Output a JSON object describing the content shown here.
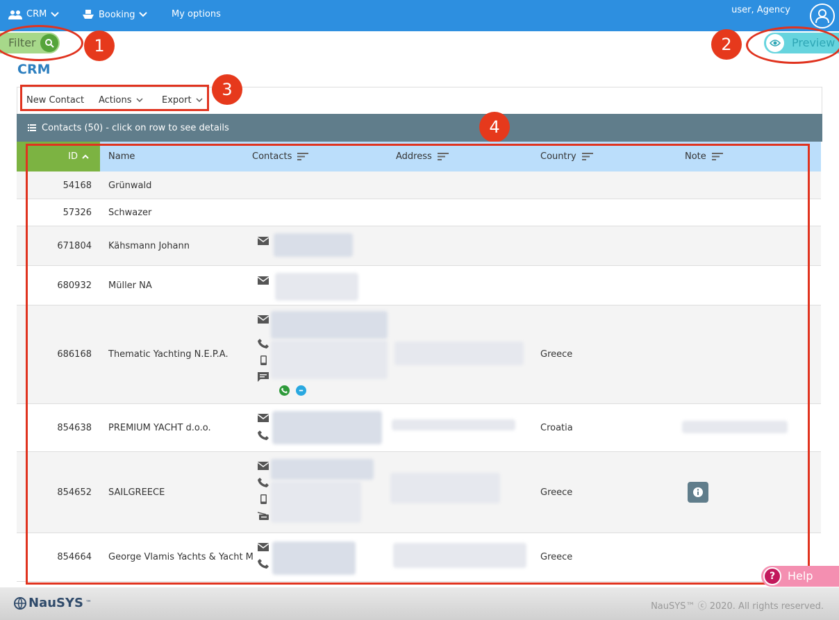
{
  "topbar": {
    "crm": "CRM",
    "booking": "Booking",
    "my_options": "My options",
    "user": "user, Agency",
    "bg_color": "#2d8fe0"
  },
  "filter_label": "Filter",
  "preview_label": "Preview",
  "page_title": "CRM",
  "toolbar": {
    "new_contact": "New Contact",
    "actions": "Actions",
    "export": "Export"
  },
  "panel_title": "Contacts (50) - click on row to see details",
  "annotations": [
    "1",
    "2",
    "3",
    "4"
  ],
  "table": {
    "columns": {
      "id": "ID",
      "name": "Name",
      "contacts": "Contacts",
      "address": "Address",
      "country": "Country",
      "note": "Note"
    },
    "rows": [
      {
        "id": "54168",
        "name": "Grünwald",
        "country": ""
      },
      {
        "id": "57326",
        "name": "Schwazer",
        "country": ""
      },
      {
        "id": "671804",
        "name": "Kähsmann Johann",
        "country": ""
      },
      {
        "id": "680932",
        "name": "Müller NA",
        "country": ""
      },
      {
        "id": "686168",
        "name": "Thematic Yachting N.E.P.A.",
        "country": "Greece"
      },
      {
        "id": "854638",
        "name": "PREMIUM YACHT d.o.o.",
        "country": "Croatia"
      },
      {
        "id": "854652",
        "name": "SAILGREECE",
        "country": "Greece"
      },
      {
        "id": "854664",
        "name": "George Vlamis Yachts & Yacht M",
        "country": "Greece"
      }
    ]
  },
  "help_label": "Help",
  "footer": {
    "logo": "NauSYS",
    "tm": "™",
    "copyright": "NauSYS™ ⓒ 2020. All rights reserved."
  },
  "colors": {
    "accent": "#2d8fe0",
    "annotation": "#e0331f",
    "filter": "#a7d88a",
    "preview": "#66d4de",
    "panel_header": "#607d8b",
    "table_header": "#bbdefb",
    "id_sorted": "#7cb342"
  },
  "icons": [
    "people-icon",
    "ship-icon",
    "chevron-down-icon",
    "user-avatar-icon",
    "search-icon",
    "eye-icon",
    "list-icon",
    "sort-asc-icon",
    "sort-lines-icon",
    "mail-icon",
    "phone-icon",
    "mobile-icon",
    "message-icon",
    "fax-icon",
    "call-green-icon",
    "skype-icon",
    "info-icon",
    "help-icon"
  ]
}
